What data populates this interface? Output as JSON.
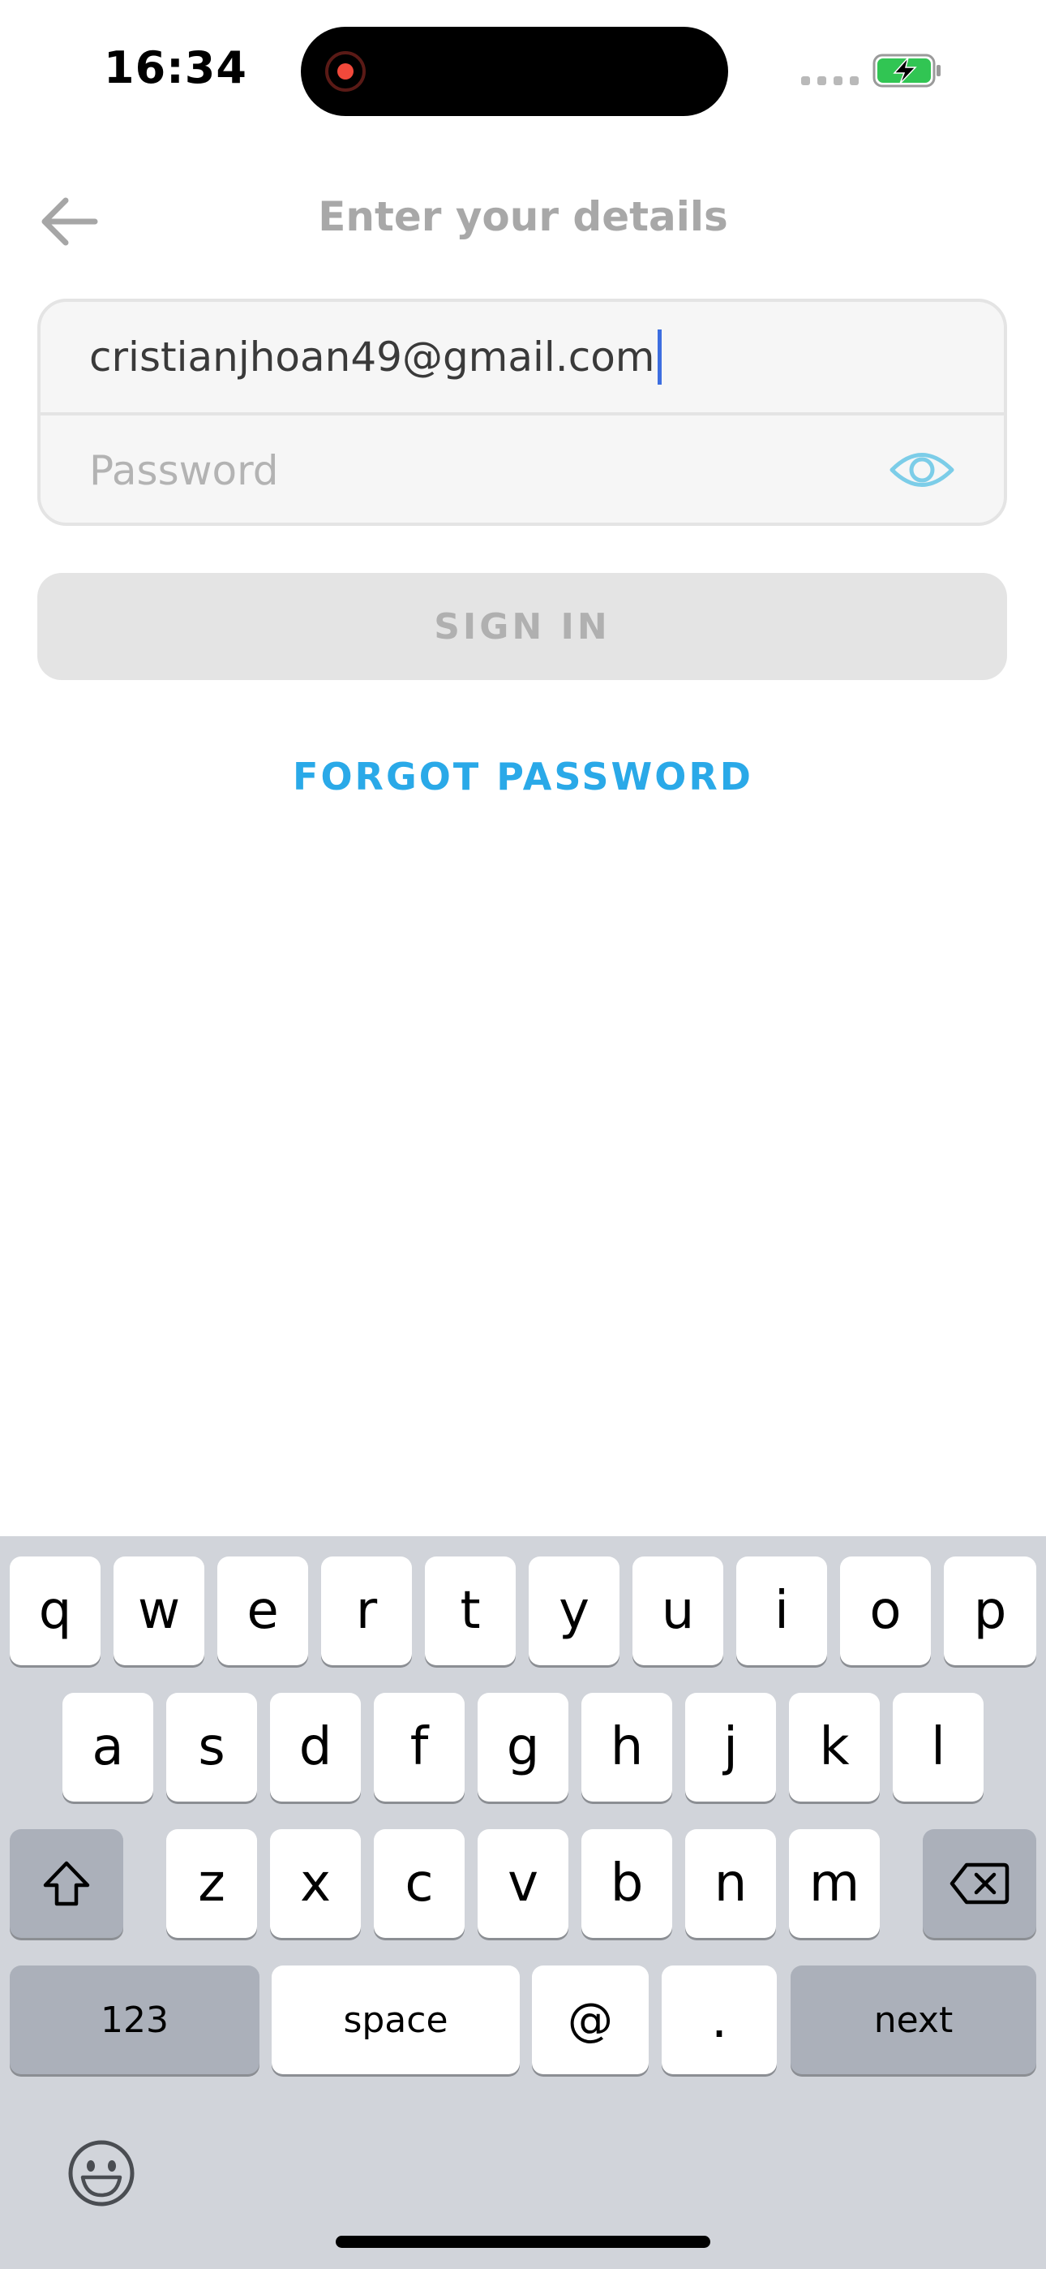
{
  "status_bar": {
    "time": "16:34",
    "battery_color": "#31c553"
  },
  "header": {
    "title": "Enter your details",
    "back_icon": "arrow-left-icon"
  },
  "form": {
    "email_value": "cristianjhoan49@gmail.com",
    "password_placeholder": "Password",
    "eye_icon": "eye-icon",
    "eye_color": "#7ccde8"
  },
  "actions": {
    "sign_in_label": "SIGN IN",
    "forgot_password_label": "FORGOT PASSWORD",
    "link_color": "#2aa9e8"
  },
  "keyboard": {
    "row1": [
      "q",
      "w",
      "e",
      "r",
      "t",
      "y",
      "u",
      "i",
      "o",
      "p"
    ],
    "row2": [
      "a",
      "s",
      "d",
      "f",
      "g",
      "h",
      "j",
      "k",
      "l"
    ],
    "row3": [
      "z",
      "x",
      "c",
      "v",
      "b",
      "n",
      "m"
    ],
    "numbers_label": "123",
    "space_label": "space",
    "at_label": "@",
    "dot_label": ".",
    "next_label": "next",
    "shift_icon": "shift-icon",
    "backspace_icon": "backspace-icon",
    "emoji_icon": "emoji-icon"
  }
}
